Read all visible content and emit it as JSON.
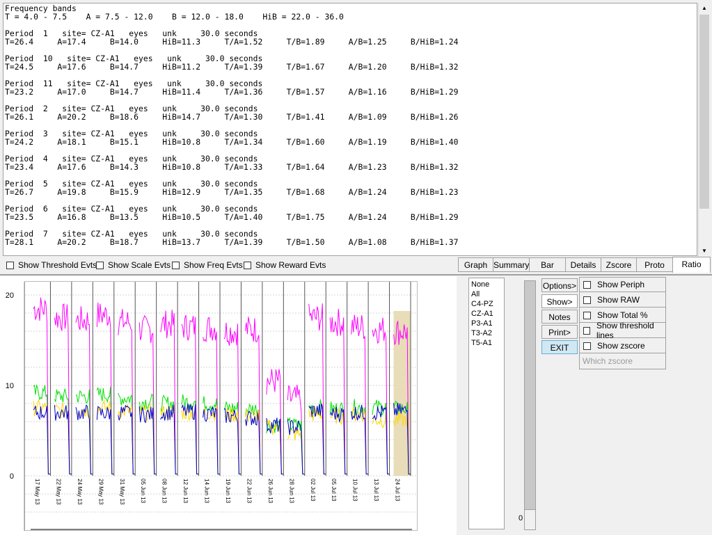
{
  "report": {
    "lines": [
      "Frequency bands",
      "T = 4.0 - 7.5    A = 7.5 - 12.0    B = 12.0 - 18.0    HiB = 22.0 - 36.0",
      "",
      "Period  1   site= CZ-A1   eyes   unk     30.0 seconds",
      "T=26.4     A=17.4     B=14.0     HiB=11.3     T/A=1.52     T/B=1.89     A/B=1.25     B/HiB=1.24",
      "",
      "Period  10   site= CZ-A1   eyes   unk     30.0 seconds",
      "T=24.5     A=17.6     B=14.7     HiB=11.2     T/A=1.39     T/B=1.67     A/B=1.20     B/HiB=1.32",
      "",
      "Period  11   site= CZ-A1   eyes   unk     30.0 seconds",
      "T=23.2     A=17.0     B=14.7     HiB=11.4     T/A=1.36     T/B=1.57     A/B=1.16     B/HiB=1.29",
      "",
      "Period  2   site= CZ-A1   eyes   unk     30.0 seconds",
      "T=26.1     A=20.2     B=18.6     HiB=14.7     T/A=1.30     T/B=1.41     A/B=1.09     B/HiB=1.26",
      "",
      "Period  3   site= CZ-A1   eyes   unk     30.0 seconds",
      "T=24.2     A=18.1     B=15.1     HiB=10.8     T/A=1.34     T/B=1.60     A/B=1.19     B/HiB=1.40",
      "",
      "Period  4   site= CZ-A1   eyes   unk     30.0 seconds",
      "T=23.4     A=17.6     B=14.3     HiB=10.8     T/A=1.33     T/B=1.64     A/B=1.23     B/HiB=1.32",
      "",
      "Period  5   site= CZ-A1   eyes   unk     30.0 seconds",
      "T=26.7     A=19.8     B=15.9     HiB=12.9     T/A=1.35     T/B=1.68     A/B=1.24     B/HiB=1.23",
      "",
      "Period  6   site= CZ-A1   eyes   unk     30.0 seconds",
      "T=23.5     A=16.8     B=13.5     HiB=10.5     T/A=1.40     T/B=1.75     A/B=1.24     B/HiB=1.29",
      "",
      "Period  7   site= CZ-A1   eyes   unk     30.0 seconds",
      "T=28.1     A=20.2     B=18.7     HiB=13.7     T/A=1.39     T/B=1.50     A/B=1.08     B/HiB=1.37"
    ]
  },
  "checkboxes": {
    "threshold": "Show Threshold Evts",
    "scale": "Show Scale Evts",
    "freq": "Show Freq Evts",
    "reward": "Show Reward Evts"
  },
  "tabs": [
    "Graph",
    "Summary",
    "Bar",
    "Details",
    "Zscore",
    "Proto",
    "Ratio"
  ],
  "active_tab": "Ratio",
  "sites": [
    "None",
    "All",
    "C4-PZ",
    "CZ-A1",
    "P3-A1",
    "T3-A2",
    "T5-A1"
  ],
  "slider_value": "0",
  "buttons": {
    "options": "Options>",
    "show": "Show>",
    "notes": "Notes",
    "print": "Print>",
    "exit": "EXIT"
  },
  "options": {
    "periph": "Show Periph",
    "raw": "Show RAW",
    "total": "Show Total %",
    "threshold_lines": "Show threshold lines",
    "zscore": "Show zscore",
    "which_zscore": "Which zscore"
  },
  "chart_data": {
    "type": "line",
    "ylim": [
      0,
      20
    ],
    "yticks": [
      "0",
      "10",
      "20"
    ],
    "session_labels": [
      "17 May 13",
      "22 May 13",
      "24 May 13",
      "29 May 13",
      "31 May 13",
      "05 Jun 13",
      "08 Jun 13",
      "12 Jun 13",
      "14 Jun 13",
      "19 Jun 13",
      "22 Jun 13",
      "26 Jun 13",
      "28 Jun 13",
      "02 Jul 13",
      "05 Jul 13",
      "10 Jul 13",
      "13 Jul 13",
      "24 Jul 13"
    ],
    "series": [
      {
        "color": "#ff00ff",
        "values": [
          18.5,
          17.5,
          17.2,
          17.8,
          17.0,
          16.2,
          16.8,
          16.5,
          16.4,
          16.0,
          16.2,
          10.5,
          8.5,
          17.5,
          17.0,
          16.5,
          16.2,
          16.0
        ]
      },
      {
        "color": "#00e000",
        "values": [
          9.2,
          8.8,
          8.8,
          9.0,
          8.6,
          8.2,
          8.0,
          8.2,
          8.0,
          7.5,
          7.4,
          5.6,
          5.6,
          7.6,
          7.4,
          7.6,
          7.6,
          7.4
        ]
      },
      {
        "color": "#ffd700",
        "values": [
          7.5,
          7.2,
          7.3,
          7.5,
          7.2,
          7.0,
          7.0,
          7.0,
          7.0,
          6.8,
          6.6,
          5.4,
          4.6,
          6.8,
          6.6,
          6.8,
          6.2,
          6.2
        ]
      },
      {
        "color": "#0000cc",
        "values": [
          7.0,
          7.0,
          7.0,
          6.9,
          7.0,
          6.8,
          7.0,
          7.1,
          6.9,
          6.6,
          6.4,
          5.6,
          5.4,
          7.2,
          6.9,
          7.0,
          7.0,
          7.2
        ]
      }
    ],
    "highlight_color": "#e8ddb8"
  }
}
